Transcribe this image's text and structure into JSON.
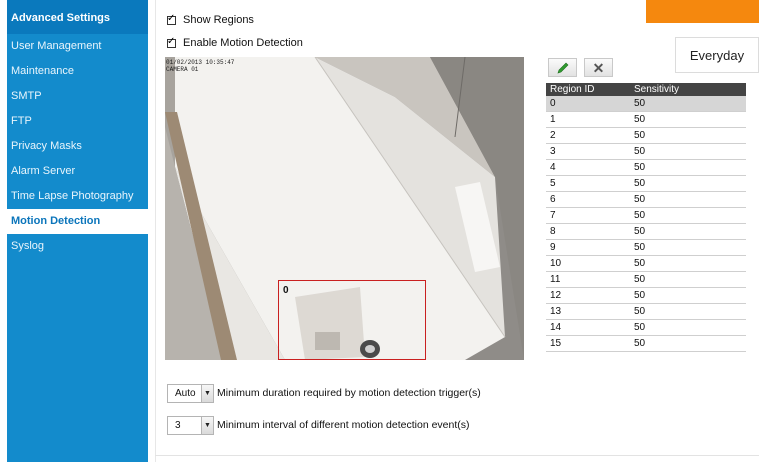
{
  "sidebar": {
    "header": "Advanced Settings",
    "items": [
      {
        "label": "User Management"
      },
      {
        "label": "Maintenance"
      },
      {
        "label": "SMTP"
      },
      {
        "label": "FTP"
      },
      {
        "label": "Privacy Masks"
      },
      {
        "label": "Alarm Server"
      },
      {
        "label": "Time Lapse Photography"
      },
      {
        "label": "Motion Detection",
        "active": true
      },
      {
        "label": "Syslog"
      }
    ]
  },
  "options": {
    "show_regions": {
      "label": "Show Regions",
      "checked": true
    },
    "enable_motion": {
      "label": "Enable Motion Detection",
      "checked": true
    }
  },
  "schedule": {
    "label": "Everyday"
  },
  "camera": {
    "osd_line1": "01/02/2013 10:35:47",
    "osd_line2": "CAMERA 01",
    "region_label": "0"
  },
  "toolbar": {
    "edit_icon": "pencil-icon",
    "delete_icon": "close-icon",
    "delete_glyph": "✕"
  },
  "table": {
    "headers": {
      "region": "Region ID",
      "sensitivity": "Sensitivity"
    },
    "selected_region": "0",
    "rows": [
      {
        "id": "0",
        "sensitivity": "50"
      },
      {
        "id": "1",
        "sensitivity": "50"
      },
      {
        "id": "2",
        "sensitivity": "50"
      },
      {
        "id": "3",
        "sensitivity": "50"
      },
      {
        "id": "4",
        "sensitivity": "50"
      },
      {
        "id": "5",
        "sensitivity": "50"
      },
      {
        "id": "6",
        "sensitivity": "50"
      },
      {
        "id": "7",
        "sensitivity": "50"
      },
      {
        "id": "8",
        "sensitivity": "50"
      },
      {
        "id": "9",
        "sensitivity": "50"
      },
      {
        "id": "10",
        "sensitivity": "50"
      },
      {
        "id": "11",
        "sensitivity": "50"
      },
      {
        "id": "12",
        "sensitivity": "50"
      },
      {
        "id": "13",
        "sensitivity": "50"
      },
      {
        "id": "14",
        "sensitivity": "50"
      },
      {
        "id": "15",
        "sensitivity": "50"
      }
    ]
  },
  "duration": {
    "value": "Auto",
    "label": "Minimum duration required by motion detection trigger(s)"
  },
  "interval": {
    "value": "3",
    "label": "Minimum interval of different motion detection event(s)"
  },
  "colors": {
    "sidebar": "#138bcc",
    "sidebar_header": "#0a79bd",
    "accent_tab": "#f5880e",
    "region_box": "#c92020",
    "table_header": "#444444"
  }
}
